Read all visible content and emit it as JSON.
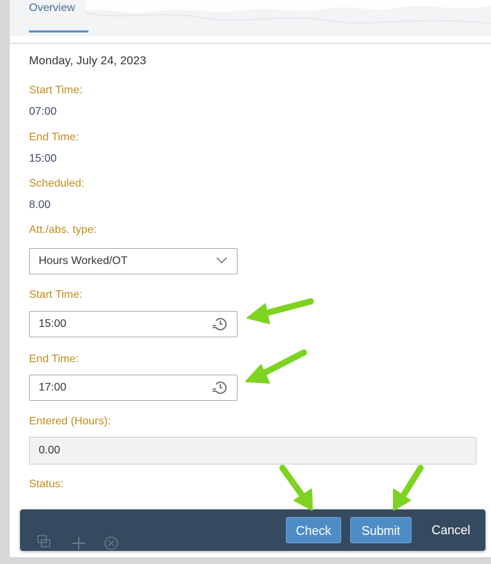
{
  "tabs": {
    "overview_label": "Overview"
  },
  "day": {
    "date": "Monday, July 24, 2023",
    "start_time_label": "Start Time:",
    "start_time_value": "07:00",
    "end_time_label": "End Time:",
    "end_time_value": "15:00",
    "scheduled_label": "Scheduled:",
    "scheduled_value": "8.00"
  },
  "form": {
    "att_abs_type_label": "Att./abs. type:",
    "att_abs_type_value": "Hours Worked/OT",
    "start_time_label": "Start Time:",
    "start_time_value": "15:00",
    "end_time_label": "End Time:",
    "end_time_value": "17:00",
    "entered_hours_label": "Entered (Hours):",
    "entered_hours_value": "0.00",
    "status_label": "Status:"
  },
  "footer": {
    "check_label": "Check",
    "submit_label": "Submit",
    "cancel_label": "Cancel",
    "icons": [
      "copy-icon",
      "add-icon",
      "remove-icon"
    ]
  },
  "colors": {
    "label": "#c28d1a",
    "value": "#3e4a6e",
    "footer_bg": "#354a5f",
    "button_blue": "#4e8cc5",
    "annotation_arrow": "#7ed321"
  }
}
